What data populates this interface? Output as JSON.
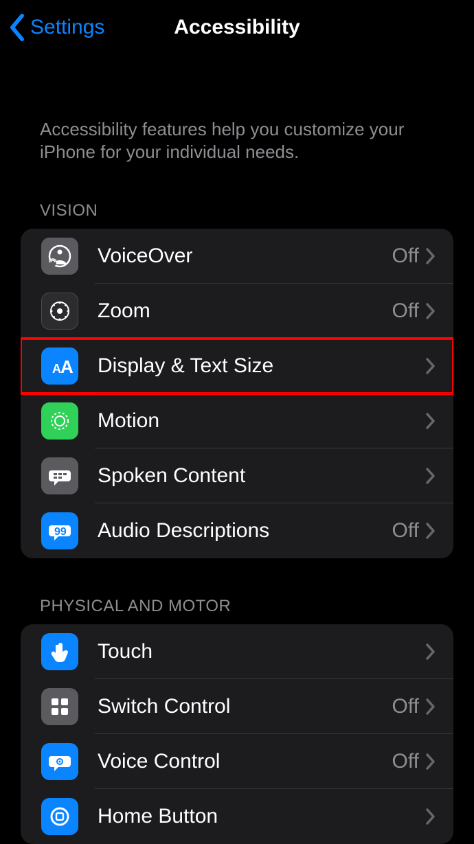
{
  "header": {
    "back_label": "Settings",
    "title": "Accessibility"
  },
  "description": "Accessibility features help you customize your iPhone for your individual needs.",
  "sections": [
    {
      "title": "VISION",
      "items": [
        {
          "label": "VoiceOver",
          "detail": "Off",
          "icon": "voiceover",
          "icon_bg": "ic-gray"
        },
        {
          "label": "Zoom",
          "detail": "Off",
          "icon": "zoom",
          "icon_bg": "ic-darkgray"
        },
        {
          "label": "Display & Text Size",
          "detail": "",
          "icon": "textsize",
          "icon_bg": "ic-blue",
          "highlighted": true
        },
        {
          "label": "Motion",
          "detail": "",
          "icon": "motion",
          "icon_bg": "ic-green"
        },
        {
          "label": "Spoken Content",
          "detail": "",
          "icon": "spoken",
          "icon_bg": "ic-gray"
        },
        {
          "label": "Audio Descriptions",
          "detail": "Off",
          "icon": "audiodesc",
          "icon_bg": "ic-blue"
        }
      ]
    },
    {
      "title": "PHYSICAL AND MOTOR",
      "items": [
        {
          "label": "Touch",
          "detail": "",
          "icon": "touch",
          "icon_bg": "ic-blue"
        },
        {
          "label": "Switch Control",
          "detail": "Off",
          "icon": "switch",
          "icon_bg": "ic-gray"
        },
        {
          "label": "Voice Control",
          "detail": "Off",
          "icon": "voicecontrol",
          "icon_bg": "ic-blue"
        },
        {
          "label": "Home Button",
          "detail": "",
          "icon": "homebutton",
          "icon_bg": "ic-blue"
        }
      ]
    }
  ]
}
